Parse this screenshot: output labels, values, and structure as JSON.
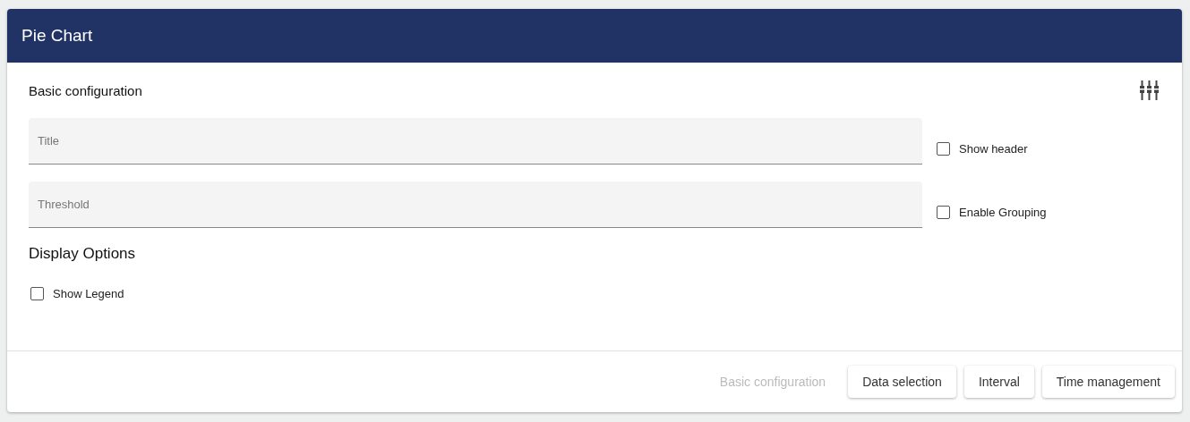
{
  "window": {
    "title": "Pie Chart"
  },
  "section": {
    "title": "Basic configuration"
  },
  "fields": [
    {
      "placeholder": "Title",
      "option": {
        "label": "Show header",
        "checked": false
      }
    },
    {
      "placeholder": "Threshold",
      "option": {
        "label": "Enable Grouping",
        "checked": false
      }
    }
  ],
  "display_options": {
    "title": "Display Options",
    "options": [
      {
        "label": "Show Legend",
        "checked": false
      }
    ]
  },
  "steps": [
    {
      "label": "Basic configuration",
      "selected": true
    },
    {
      "label": "Data selection",
      "selected": false
    },
    {
      "label": "Interval",
      "selected": false
    },
    {
      "label": "Time management",
      "selected": false
    }
  ]
}
